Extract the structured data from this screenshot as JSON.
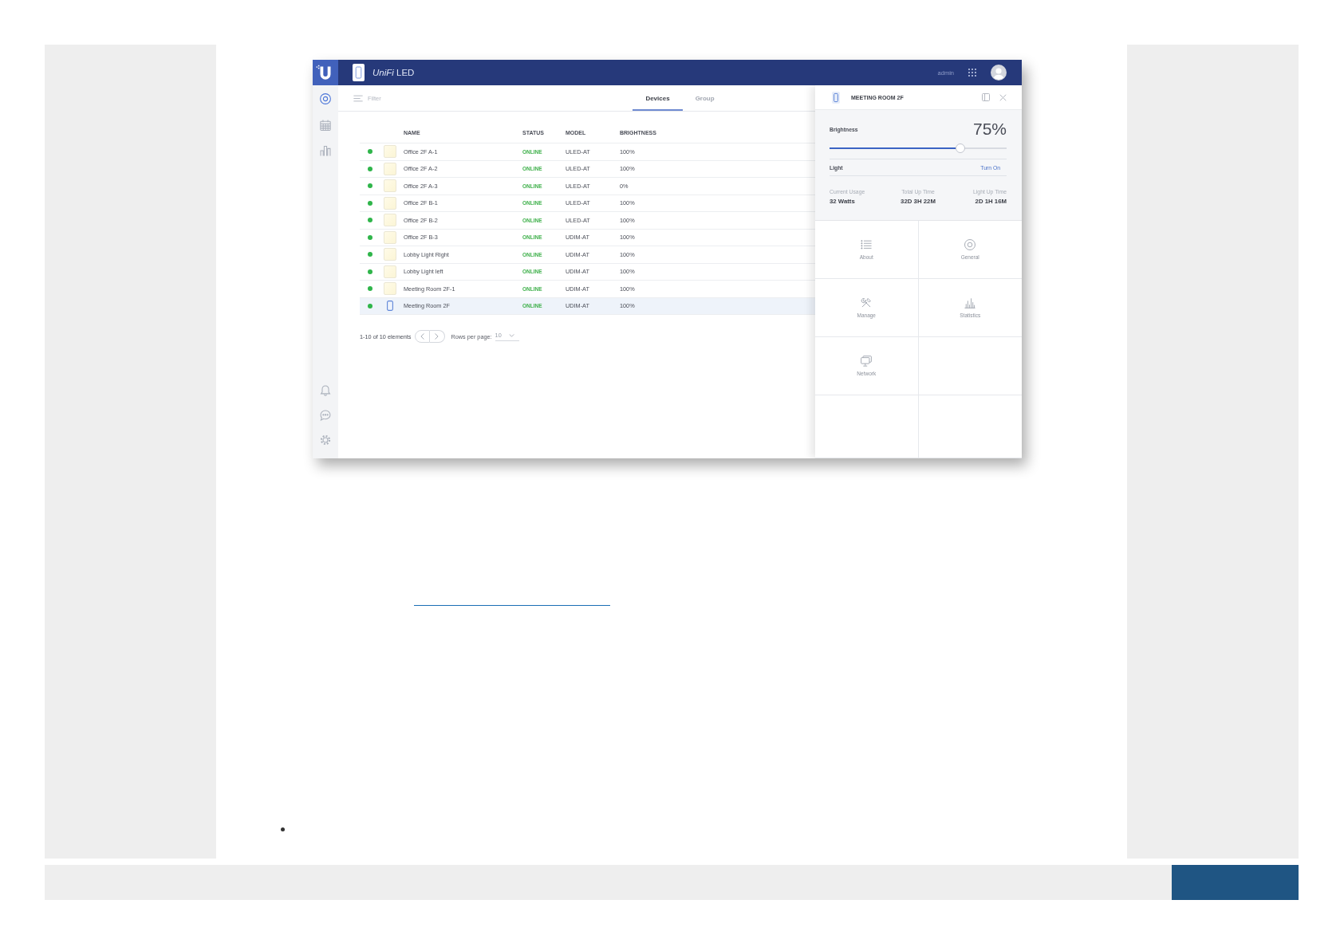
{
  "app": {
    "top_bar": {
      "product": "*UniFi* LED",
      "user": "admin"
    },
    "sidebar": {
      "top_items": [
        {
          "kind": "target",
          "selected": true
        },
        {
          "kind": "calendar",
          "selected": false
        },
        {
          "kind": "chart",
          "selected": false
        }
      ],
      "bottom_items": [
        {
          "kind": "bell"
        },
        {
          "kind": "chat"
        },
        {
          "kind": "gear"
        }
      ]
    },
    "toolbar": {
      "filter": {
        "placeholder": "Filter"
      },
      "tabs": [
        {
          "label": "Devices",
          "selected": true
        },
        {
          "label": "Group",
          "selected": false
        }
      ]
    },
    "table": {
      "columns": [
        "NAME",
        "STATUS",
        "MODEL",
        "BRIGHTNESS"
      ],
      "rows": [
        {
          "kind": "tile",
          "color": "#2fb54a",
          "name": "Office 2F A-1",
          "status": "ONLINE",
          "model": "ULED-AT",
          "brightness": "100%",
          "selected": false
        },
        {
          "kind": "tile",
          "color": "#2fb54a",
          "name": "Office 2F A-2",
          "status": "ONLINE",
          "model": "ULED-AT",
          "brightness": "100%",
          "selected": false
        },
        {
          "kind": "tile",
          "color": "#2fb54a",
          "name": "Office 2F A-3",
          "status": "ONLINE",
          "model": "ULED-AT",
          "brightness": "0%",
          "selected": false
        },
        {
          "kind": "tile",
          "color": "#2fb54a",
          "name": "Office 2F B-1",
          "status": "ONLINE",
          "model": "ULED-AT",
          "brightness": "100%",
          "selected": false
        },
        {
          "kind": "tile",
          "color": "#2fb54a",
          "name": "Office 2F B-2",
          "status": "ONLINE",
          "model": "ULED-AT",
          "brightness": "100%",
          "selected": false
        },
        {
          "kind": "tile",
          "color": "#2fb54a",
          "name": "Office 2F B-3",
          "status": "ONLINE",
          "model": "UDIM-AT",
          "brightness": "100%",
          "selected": false
        },
        {
          "kind": "tile",
          "color": "#2fb54a",
          "name": "Lobby Light Right",
          "status": "ONLINE",
          "model": "UDIM-AT",
          "brightness": "100%",
          "selected": false
        },
        {
          "kind": "tile",
          "color": "#2fb54a",
          "name": "Lobby Light left",
          "status": "ONLINE",
          "model": "UDIM-AT",
          "brightness": "100%",
          "selected": false
        },
        {
          "kind": "tile",
          "color": "#2fb54a",
          "name": "Meeting Room 2F-1",
          "status": "ONLINE",
          "model": "UDIM-AT",
          "brightness": "100%",
          "selected": false
        },
        {
          "kind": "device",
          "color": "#2fb54a",
          "name": "Meeting Room 2F",
          "status": "ONLINE",
          "model": "UDIM-AT",
          "brightness": "100%",
          "selected": true
        }
      ]
    },
    "pagination": {
      "range": "1-10 of 10 elements",
      "rows_per_page_label": "Rows per page:",
      "rows_per_page": "10"
    },
    "detail_panel": {
      "title": "MEETING ROOM 2F",
      "brightness": {
        "label": "Brightness",
        "reading": "75%",
        "level": 0.75
      },
      "light": {
        "label": "Light",
        "action": "Turn On"
      },
      "stats": [
        {
          "label": "Current Usage",
          "value": "32 Watts"
        },
        {
          "label": "Total Up Time",
          "value": "32D 3H 22M"
        },
        {
          "label": "Light Up Time",
          "value": "2D 1H 16M"
        }
      ],
      "tiles": [
        {
          "kind": "list",
          "label": "About"
        },
        {
          "kind": "target",
          "label": "General"
        },
        {
          "kind": "tools",
          "label": "Manage"
        },
        {
          "kind": "bars",
          "label": "Statistics"
        },
        {
          "kind": "monitor",
          "label": "Network"
        }
      ]
    }
  }
}
